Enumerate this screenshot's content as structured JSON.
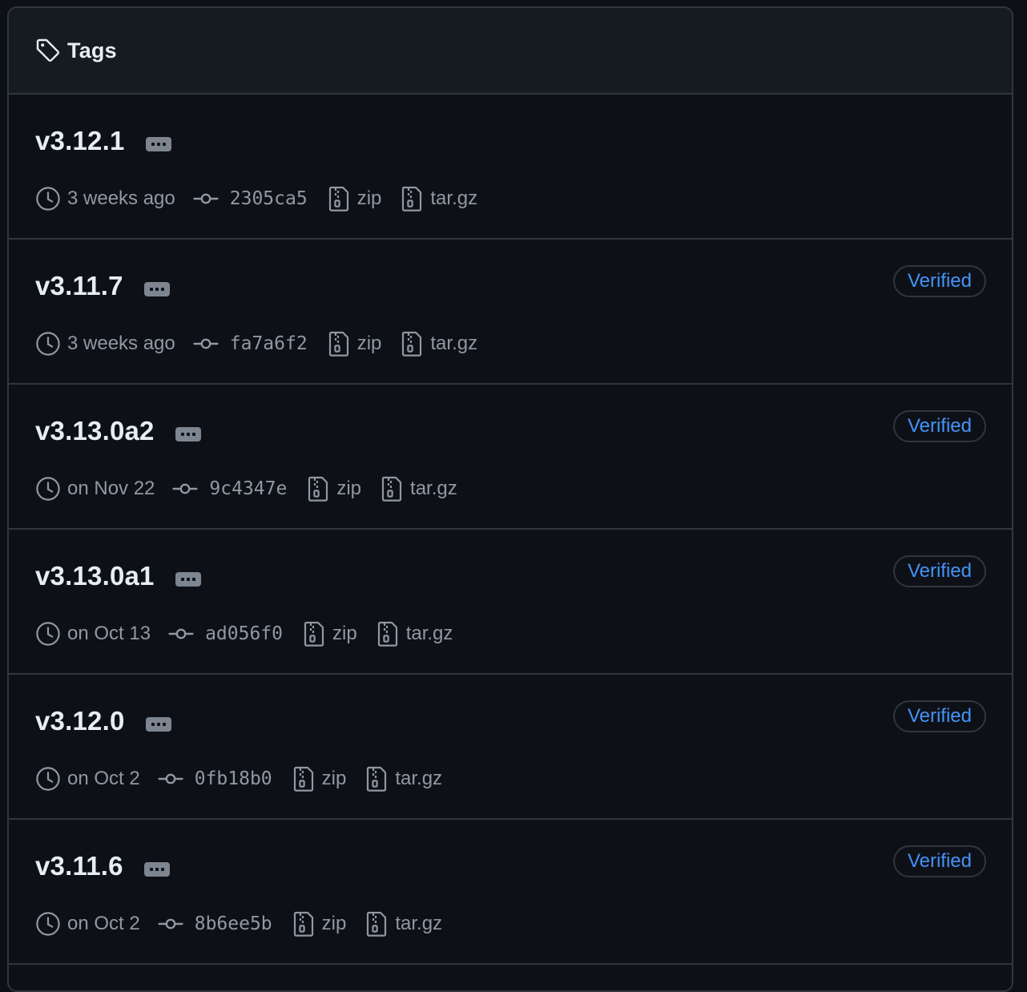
{
  "header": {
    "title": "Tags",
    "icon": "tag-icon"
  },
  "colors": {
    "background": "#0d1117",
    "header_background": "#161b22",
    "border": "#30363d",
    "text_primary": "#e6edf3",
    "text_muted": "#9198a1",
    "accent": "#4493f8"
  },
  "tags": [
    {
      "name": "v3.12.1",
      "time": "3 weeks ago",
      "sha": "2305ca5",
      "zip": "zip",
      "tar": "tar.gz",
      "verified": ""
    },
    {
      "name": "v3.11.7",
      "time": "3 weeks ago",
      "sha": "fa7a6f2",
      "zip": "zip",
      "tar": "tar.gz",
      "verified": "Verified"
    },
    {
      "name": "v3.13.0a2",
      "time": "on Nov 22",
      "sha": "9c4347e",
      "zip": "zip",
      "tar": "tar.gz",
      "verified": "Verified"
    },
    {
      "name": "v3.13.0a1",
      "time": "on Oct 13",
      "sha": "ad056f0",
      "zip": "zip",
      "tar": "tar.gz",
      "verified": "Verified"
    },
    {
      "name": "v3.12.0",
      "time": "on Oct 2",
      "sha": "0fb18b0",
      "zip": "zip",
      "tar": "tar.gz",
      "verified": "Verified"
    },
    {
      "name": "v3.11.6",
      "time": "on Oct 2",
      "sha": "8b6ee5b",
      "zip": "zip",
      "tar": "tar.gz",
      "verified": "Verified"
    }
  ]
}
